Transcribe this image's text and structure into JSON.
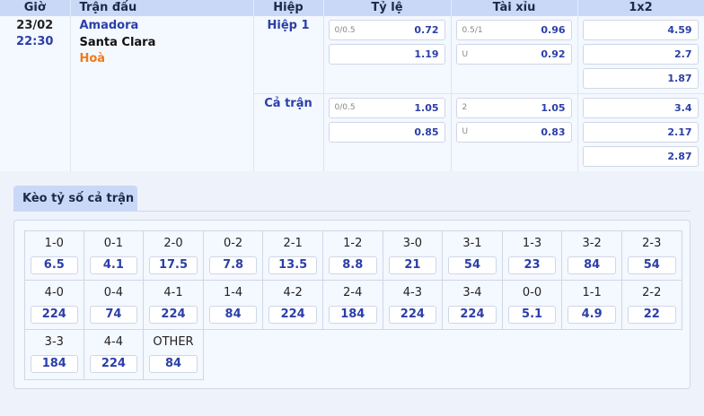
{
  "header": {
    "time": "Giờ",
    "match": "Trận đấu",
    "half": "Hiệp",
    "handicap": "Tỷ lệ",
    "overunder": "Tài xỉu",
    "onextwo": "1x2"
  },
  "match": {
    "date": "23/02",
    "time": "22:30",
    "home": "Amadora",
    "away": "Santa Clara",
    "draw": "Hoà"
  },
  "rows": [
    {
      "label": "Hiệp 1",
      "handicap": [
        {
          "hcp": "0/0.5",
          "val": "0.72"
        },
        {
          "hcp": "",
          "val": "1.19"
        }
      ],
      "overunder": [
        {
          "hcp": "0.5/1",
          "val": "0.96"
        },
        {
          "hcp": "U",
          "val": "0.92"
        }
      ],
      "onextwo": [
        "4.59",
        "2.7",
        "1.87"
      ]
    },
    {
      "label": "Cả trận",
      "handicap": [
        {
          "hcp": "0/0.5",
          "val": "1.05"
        },
        {
          "hcp": "",
          "val": "0.85"
        }
      ],
      "overunder": [
        {
          "hcp": "2",
          "val": "1.05"
        },
        {
          "hcp": "U",
          "val": "0.83"
        }
      ],
      "onextwo": [
        "3.4",
        "2.17",
        "2.87"
      ]
    }
  ],
  "score_section": {
    "title": "Kèo tỷ số cả trận",
    "scores": [
      {
        "label": "1-0",
        "odds": "6.5"
      },
      {
        "label": "0-1",
        "odds": "4.1"
      },
      {
        "label": "2-0",
        "odds": "17.5"
      },
      {
        "label": "0-2",
        "odds": "7.8"
      },
      {
        "label": "2-1",
        "odds": "13.5"
      },
      {
        "label": "1-2",
        "odds": "8.8"
      },
      {
        "label": "3-0",
        "odds": "21"
      },
      {
        "label": "3-1",
        "odds": "54"
      },
      {
        "label": "1-3",
        "odds": "23"
      },
      {
        "label": "3-2",
        "odds": "84"
      },
      {
        "label": "2-3",
        "odds": "54"
      },
      {
        "label": "4-0",
        "odds": "224"
      },
      {
        "label": "0-4",
        "odds": "74"
      },
      {
        "label": "4-1",
        "odds": "224"
      },
      {
        "label": "1-4",
        "odds": "84"
      },
      {
        "label": "4-2",
        "odds": "224"
      },
      {
        "label": "2-4",
        "odds": "184"
      },
      {
        "label": "4-3",
        "odds": "224"
      },
      {
        "label": "3-4",
        "odds": "224"
      },
      {
        "label": "0-0",
        "odds": "5.1"
      },
      {
        "label": "1-1",
        "odds": "4.9"
      },
      {
        "label": "2-2",
        "odds": "22"
      },
      {
        "label": "3-3",
        "odds": "184"
      },
      {
        "label": "4-4",
        "odds": "224"
      },
      {
        "label": "OTHER",
        "odds": "84"
      }
    ]
  }
}
